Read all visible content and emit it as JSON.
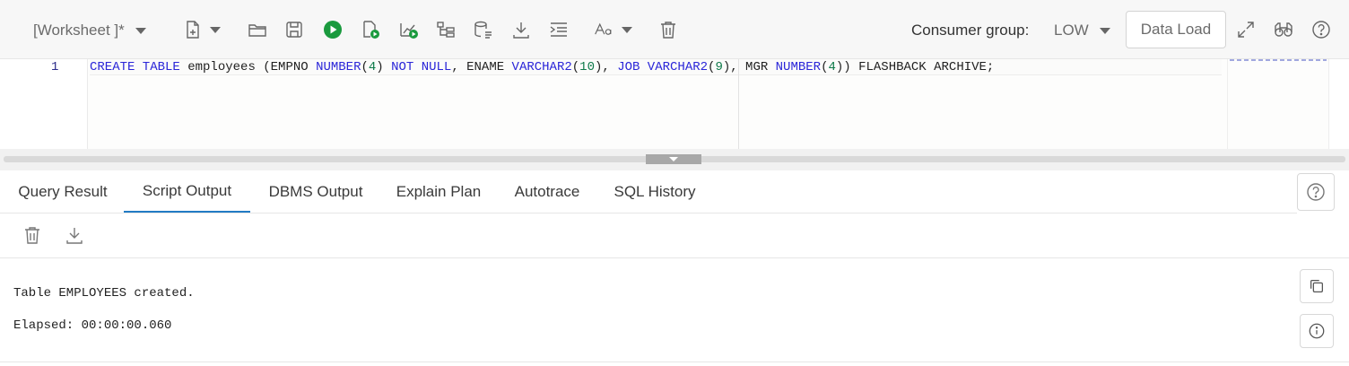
{
  "toolbar": {
    "worksheet_label": "[Worksheet ]*",
    "consumer_group_label": "Consumer group:",
    "consumer_group_value": "LOW",
    "data_load_label": "Data Load",
    "icons": [
      "new-worksheet-icon",
      "open-icon",
      "save-icon",
      "run-statement-icon",
      "run-script-icon",
      "explain-plan-icon",
      "autotrace-icon",
      "sql-history-icon",
      "download-icon",
      "format-icon",
      "font-size-icon",
      "clear-icon",
      "expand-icon",
      "binoculars-icon",
      "help-icon"
    ],
    "run_color": "#1a9a3e"
  },
  "editor": {
    "line_number": "1",
    "code_tokens": [
      {
        "t": "CREATE TABLE",
        "c": "kw"
      },
      {
        "t": " employees (EMPNO ",
        "c": ""
      },
      {
        "t": "NUMBER",
        "c": "kw"
      },
      {
        "t": "(",
        "c": ""
      },
      {
        "t": "4",
        "c": "num"
      },
      {
        "t": ") ",
        "c": ""
      },
      {
        "t": "NOT NULL",
        "c": "kw"
      },
      {
        "t": ", ENAME ",
        "c": ""
      },
      {
        "t": "VARCHAR2",
        "c": "kw"
      },
      {
        "t": "(",
        "c": ""
      },
      {
        "t": "10",
        "c": "num"
      },
      {
        "t": "), ",
        "c": ""
      },
      {
        "t": "JOB VARCHAR2",
        "c": "kw"
      },
      {
        "t": "(",
        "c": ""
      },
      {
        "t": "9",
        "c": "num"
      },
      {
        "t": "), MGR ",
        "c": ""
      },
      {
        "t": "NUMBER",
        "c": "kw"
      },
      {
        "t": "(",
        "c": ""
      },
      {
        "t": "4",
        "c": "num"
      },
      {
        "t": ")) FLASHBACK ARCHIVE;",
        "c": ""
      }
    ]
  },
  "tabs": [
    {
      "label": "Query Result",
      "active": false
    },
    {
      "label": "Script Output",
      "active": true
    },
    {
      "label": "DBMS Output",
      "active": false
    },
    {
      "label": "Explain Plan",
      "active": false
    },
    {
      "label": "Autotrace",
      "active": false
    },
    {
      "label": "SQL History",
      "active": false
    }
  ],
  "output": {
    "lines": [
      "Table EMPLOYEES created.",
      "Elapsed: 00:00:00.060"
    ]
  },
  "colors": {
    "accent": "#227bc4",
    "keyword": "#2a25d8",
    "number": "#0e7a4a"
  }
}
